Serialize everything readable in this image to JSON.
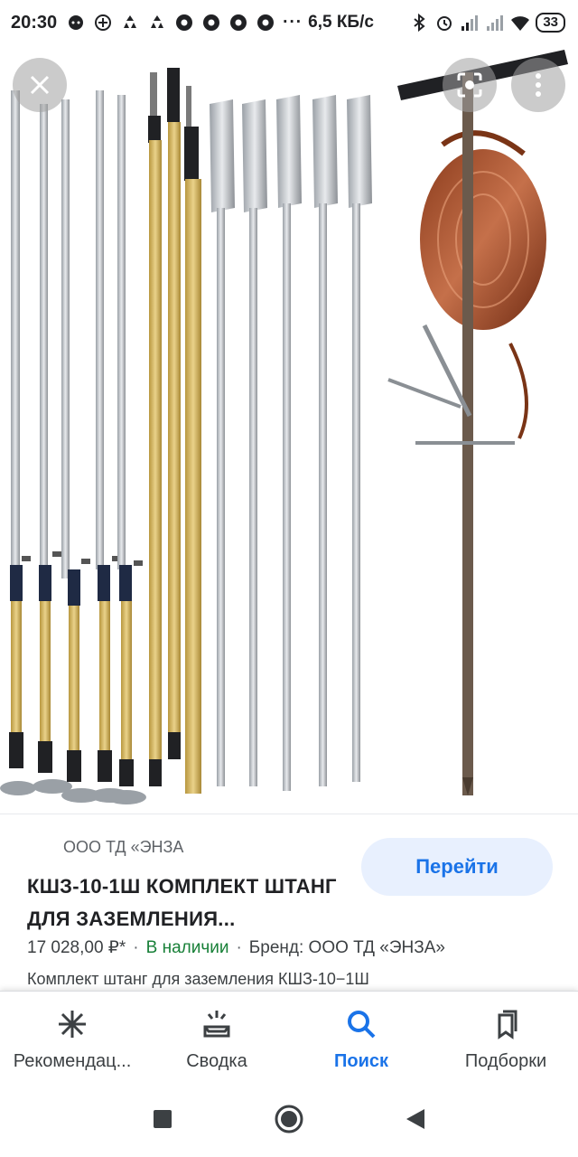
{
  "status_bar": {
    "time": "20:30",
    "dots": "···",
    "speed": "6,5 КБ/с",
    "battery": "33"
  },
  "image_viewer": {
    "close_icon": "close-icon",
    "lens_icon": "lens-icon",
    "more_icon": "more-vert-icon"
  },
  "product": {
    "seller": "ООО ТД «ЭНЗА",
    "go_button": "Перейти",
    "title": "КШЗ-10-1Ш КОМПЛЕКТ ШТАНГ ДЛЯ ЗАЗЕМЛЕНИЯ...",
    "price": "17 028,00 ₽*",
    "availability": "В наличии",
    "brand": "Бренд: ООО ТД «ЭНЗА»",
    "description": "Комплект штанг для заземления КШЗ-10−1Ш",
    "separator": "·"
  },
  "bottom_nav": {
    "items": [
      {
        "label": "Рекомендац...",
        "icon": "asterisk-icon",
        "active": false
      },
      {
        "label": "Сводка",
        "icon": "updates-icon",
        "active": false
      },
      {
        "label": "Поиск",
        "icon": "search-icon",
        "active": true
      },
      {
        "label": "Подборки",
        "icon": "collections-icon",
        "active": false
      }
    ]
  },
  "colors": {
    "accent": "#1a73e8",
    "available": "#188038",
    "button_bg": "#e8f0fe"
  }
}
